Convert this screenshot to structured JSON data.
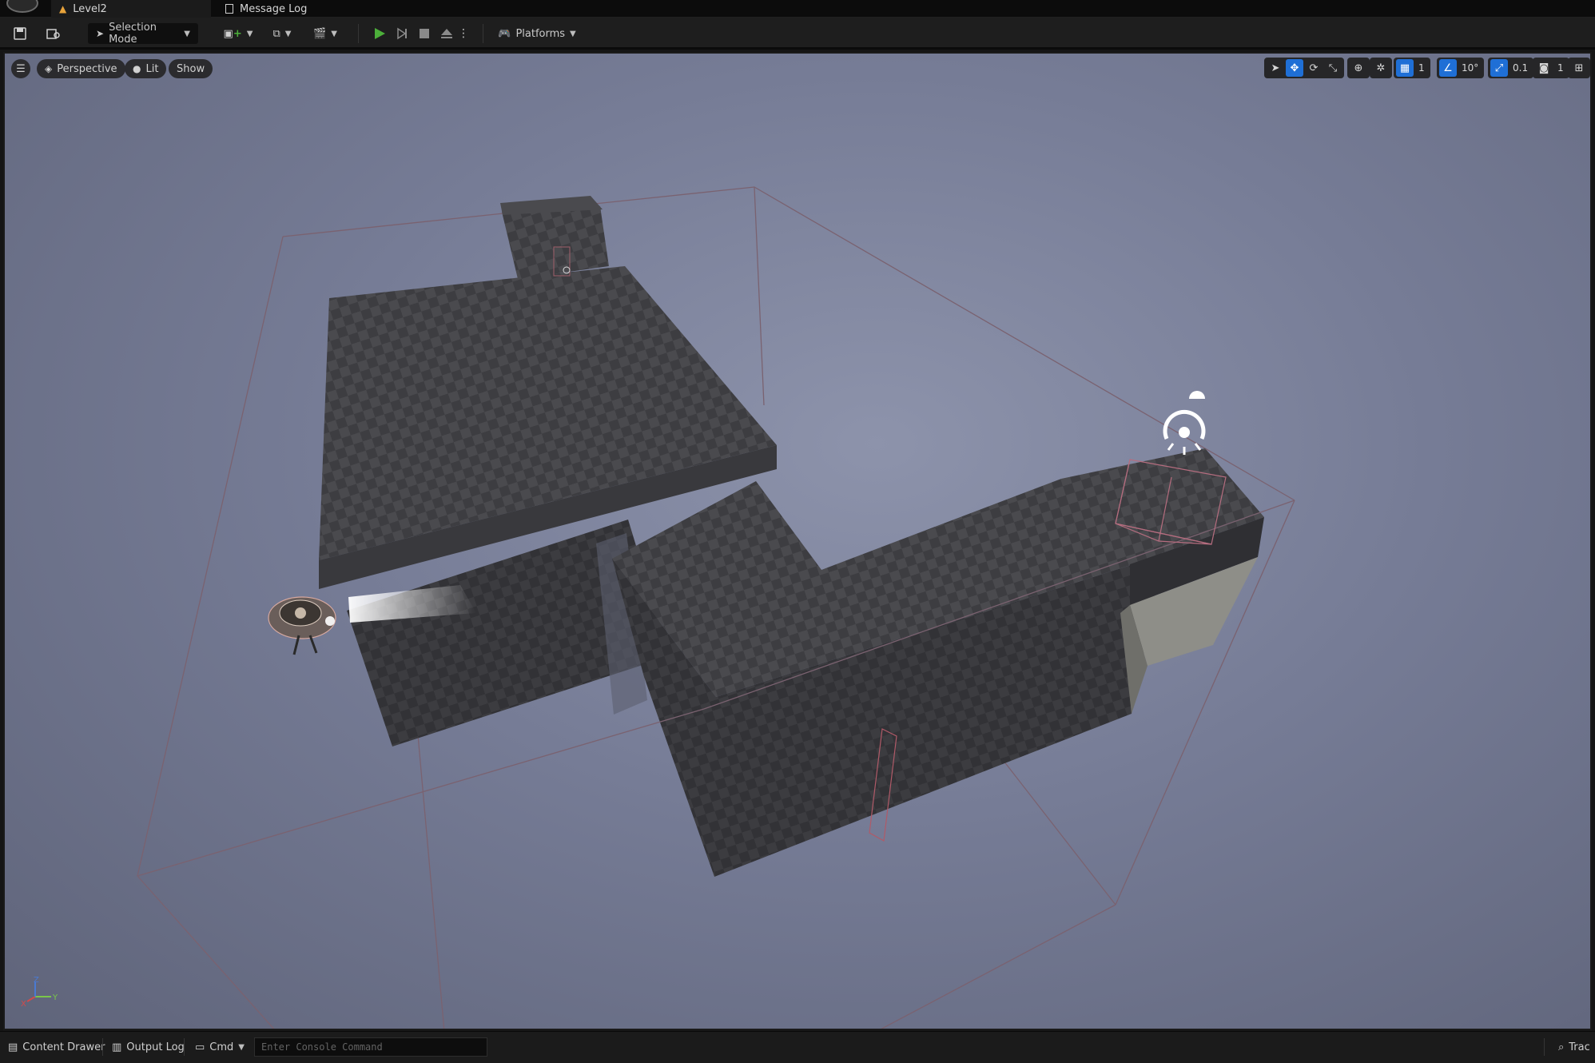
{
  "tabs": [
    {
      "label": "Level2",
      "active": true
    },
    {
      "label": "Message Log",
      "active": false
    }
  ],
  "toolbar": {
    "selection_mode_label": "Selection Mode",
    "platforms_label": "Platforms"
  },
  "viewport": {
    "perspective_label": "Perspective",
    "lit_label": "Lit",
    "show_label": "Show",
    "grid_snap_value": "1",
    "rotation_snap_value": "10°",
    "scale_snap_value": "0.1",
    "camera_speed_value": "1"
  },
  "bottom": {
    "content_drawer_label": "Content Drawer",
    "output_log_label": "Output Log",
    "cmd_label": "Cmd",
    "console_placeholder": "Enter Console Command",
    "trace_label": "Trac"
  },
  "colors": {
    "accent_blue": "#1f6fd6",
    "play_green": "#4caf3a",
    "viewport_bg": "#767c96"
  }
}
